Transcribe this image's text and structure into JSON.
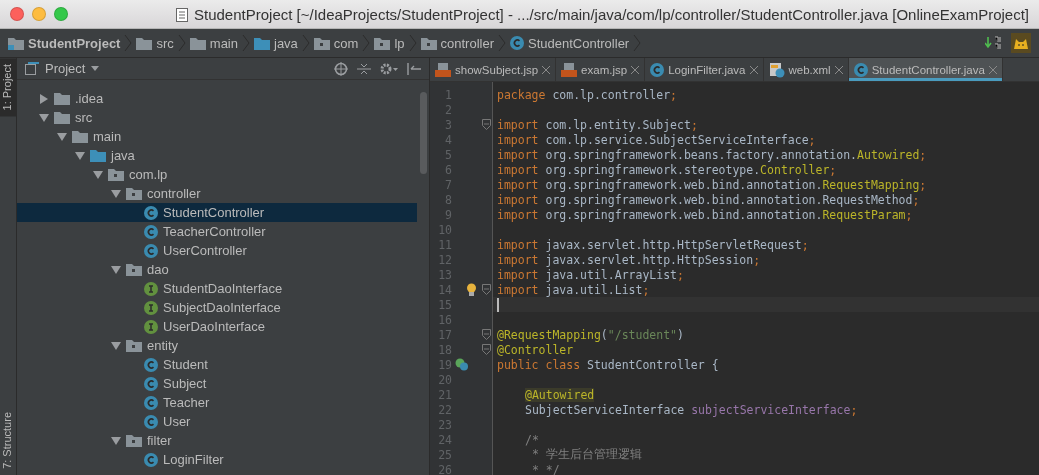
{
  "window": {
    "title": "StudentProject [~/IdeaProjects/StudentProject] - .../src/main/java/com/lp/controller/StudentController.java [OnlineExamProject]"
  },
  "breadcrumbs": [
    {
      "label": "StudentProject",
      "kind": "project"
    },
    {
      "label": "src",
      "kind": "folder"
    },
    {
      "label": "main",
      "kind": "folder"
    },
    {
      "label": "java",
      "kind": "source"
    },
    {
      "label": "com",
      "kind": "package"
    },
    {
      "label": "lp",
      "kind": "package"
    },
    {
      "label": "controller",
      "kind": "package"
    },
    {
      "label": "StudentController",
      "kind": "class"
    }
  ],
  "tool_strip": [
    {
      "label": "1: Project",
      "selected": true
    },
    {
      "label": "7: Structure",
      "selected": false
    }
  ],
  "project_panel": {
    "title": "Project",
    "tree": [
      {
        "label": ".idea",
        "kind": "folder",
        "expanded": false,
        "selected": false
      },
      {
        "label": "src",
        "kind": "folder",
        "expanded": true,
        "selected": false,
        "children": [
          {
            "label": "main",
            "kind": "folder",
            "expanded": true,
            "selected": false,
            "children": [
              {
                "label": "java",
                "kind": "source",
                "expanded": true,
                "selected": false,
                "children": [
                  {
                    "label": "com.lp",
                    "kind": "package",
                    "expanded": true,
                    "selected": false,
                    "children": [
                      {
                        "label": "controller",
                        "kind": "package",
                        "expanded": true,
                        "selected": false,
                        "children": [
                          {
                            "label": "StudentController",
                            "kind": "class",
                            "selected": true
                          },
                          {
                            "label": "TeacherController",
                            "kind": "class",
                            "selected": false
                          },
                          {
                            "label": "UserController",
                            "kind": "class",
                            "selected": false
                          }
                        ]
                      },
                      {
                        "label": "dao",
                        "kind": "package",
                        "expanded": true,
                        "selected": false,
                        "children": [
                          {
                            "label": "StudentDaoInterface",
                            "kind": "interface",
                            "selected": false
                          },
                          {
                            "label": "SubjectDaoInterface",
                            "kind": "interface",
                            "selected": false
                          },
                          {
                            "label": "UserDaoInterface",
                            "kind": "interface",
                            "selected": false
                          }
                        ]
                      },
                      {
                        "label": "entity",
                        "kind": "package",
                        "expanded": true,
                        "selected": false,
                        "children": [
                          {
                            "label": "Student",
                            "kind": "class",
                            "selected": false
                          },
                          {
                            "label": "Subject",
                            "kind": "class",
                            "selected": false
                          },
                          {
                            "label": "Teacher",
                            "kind": "class",
                            "selected": false
                          },
                          {
                            "label": "User",
                            "kind": "class",
                            "selected": false
                          }
                        ]
                      },
                      {
                        "label": "filter",
                        "kind": "package",
                        "expanded": true,
                        "selected": false,
                        "children": [
                          {
                            "label": "LoginFilter",
                            "kind": "class",
                            "selected": false
                          }
                        ]
                      }
                    ]
                  }
                ]
              }
            ]
          }
        ]
      }
    ]
  },
  "tabs": [
    {
      "label": "showSubject.jsp",
      "kind": "jsp",
      "selected": false
    },
    {
      "label": "exam.jsp",
      "kind": "jsp",
      "selected": false
    },
    {
      "label": "LoginFilter.java",
      "kind": "class",
      "selected": false
    },
    {
      "label": "web.xml",
      "kind": "xml",
      "selected": false
    },
    {
      "label": "StudentController.java",
      "kind": "class",
      "selected": true
    }
  ],
  "code": [
    {
      "number": "1",
      "tokens": [
        {
          "kind": "keyword",
          "text": "package "
        },
        {
          "kind": "plain",
          "text": "com.lp.controller"
        },
        {
          "kind": "keyword",
          "text": ";"
        }
      ]
    },
    {
      "number": "2"
    },
    {
      "number": "3",
      "fold": true,
      "tokens": [
        {
          "kind": "keyword",
          "text": "import "
        },
        {
          "kind": "plain",
          "text": "com.lp.entity.Subject"
        },
        {
          "kind": "keyword",
          "text": ";"
        }
      ]
    },
    {
      "number": "4",
      "tokens": [
        {
          "kind": "keyword",
          "text": "import "
        },
        {
          "kind": "plain",
          "text": "com.lp.service.SubjectServiceInterface"
        },
        {
          "kind": "keyword",
          "text": ";"
        }
      ]
    },
    {
      "number": "5",
      "tokens": [
        {
          "kind": "keyword",
          "text": "import "
        },
        {
          "kind": "plain",
          "text": "org.springframework.beans.factory.annotation."
        },
        {
          "kind": "annotation",
          "text": "Autowired"
        },
        {
          "kind": "keyword",
          "text": ";"
        }
      ]
    },
    {
      "number": "6",
      "tokens": [
        {
          "kind": "keyword",
          "text": "import "
        },
        {
          "kind": "plain",
          "text": "org.springframework.stereotype."
        },
        {
          "kind": "annotation",
          "text": "Controller"
        },
        {
          "kind": "keyword",
          "text": ";"
        }
      ]
    },
    {
      "number": "7",
      "tokens": [
        {
          "kind": "keyword",
          "text": "import "
        },
        {
          "kind": "plain",
          "text": "org.springframework.web.bind.annotation."
        },
        {
          "kind": "annotation",
          "text": "RequestMapping"
        },
        {
          "kind": "keyword",
          "text": ";"
        }
      ]
    },
    {
      "number": "8",
      "tokens": [
        {
          "kind": "keyword",
          "text": "import "
        },
        {
          "kind": "plain",
          "text": "org.springframework.web.bind.annotation.RequestMethod"
        },
        {
          "kind": "keyword",
          "text": ";"
        }
      ]
    },
    {
      "number": "9",
      "tokens": [
        {
          "kind": "keyword",
          "text": "import "
        },
        {
          "kind": "plain",
          "text": "org.springframework.web.bind.annotation."
        },
        {
          "kind": "annotation",
          "text": "RequestParam"
        },
        {
          "kind": "keyword",
          "text": ";"
        }
      ]
    },
    {
      "number": "10"
    },
    {
      "number": "11",
      "tokens": [
        {
          "kind": "keyword",
          "text": "import "
        },
        {
          "kind": "plain",
          "text": "javax.servlet.http.HttpServletRequest"
        },
        {
          "kind": "keyword",
          "text": ";"
        }
      ]
    },
    {
      "number": "12",
      "tokens": [
        {
          "kind": "keyword",
          "text": "import "
        },
        {
          "kind": "plain",
          "text": "javax.servlet.http.HttpSession"
        },
        {
          "kind": "keyword",
          "text": ";"
        }
      ]
    },
    {
      "number": "13",
      "tokens": [
        {
          "kind": "keyword",
          "text": "import "
        },
        {
          "kind": "plain",
          "text": "java.util.ArrayList"
        },
        {
          "kind": "keyword",
          "text": ";"
        }
      ]
    },
    {
      "number": "14",
      "fold": true,
      "bulb": true,
      "tokens": [
        {
          "kind": "keyword",
          "text": "import "
        },
        {
          "kind": "plain",
          "text": "java.util.List"
        },
        {
          "kind": "keyword",
          "text": ";"
        }
      ]
    },
    {
      "number": "15",
      "current": true
    },
    {
      "number": "16"
    },
    {
      "number": "17",
      "fold": true,
      "tokens": [
        {
          "kind": "annotation",
          "text": "@RequestMapping"
        },
        {
          "kind": "plain",
          "text": "("
        },
        {
          "kind": "string",
          "text": "\"/student\""
        },
        {
          "kind": "plain",
          "text": ")"
        }
      ]
    },
    {
      "number": "18",
      "fold": true,
      "tokens": [
        {
          "kind": "annotation",
          "text": "@Controller"
        }
      ]
    },
    {
      "number": "19",
      "bean": true,
      "tokens": [
        {
          "kind": "keyword",
          "text": "public class "
        },
        {
          "kind": "plain",
          "text": "StudentController {"
        }
      ]
    },
    {
      "number": "20"
    },
    {
      "number": "21",
      "indented": true,
      "tokens": [
        {
          "kind": "highlight",
          "text": "@Autowired"
        }
      ]
    },
    {
      "number": "22",
      "indented": true,
      "tokens": [
        {
          "kind": "plain",
          "text": "SubjectServiceInterface "
        },
        {
          "kind": "field",
          "text": "subjectServiceInterface"
        },
        {
          "kind": "keyword",
          "text": ";"
        }
      ]
    },
    {
      "number": "23"
    },
    {
      "number": "24",
      "indented": true,
      "tokens": [
        {
          "kind": "comment",
          "text": "/*"
        }
      ]
    },
    {
      "number": "25",
      "indented": true,
      "tokens": [
        {
          "kind": "comment",
          "text": " * 学生后台管理逻辑"
        }
      ]
    },
    {
      "number": "26",
      "indented": true,
      "tokens": [
        {
          "kind": "comment",
          "text": " * */"
        }
      ]
    }
  ]
}
